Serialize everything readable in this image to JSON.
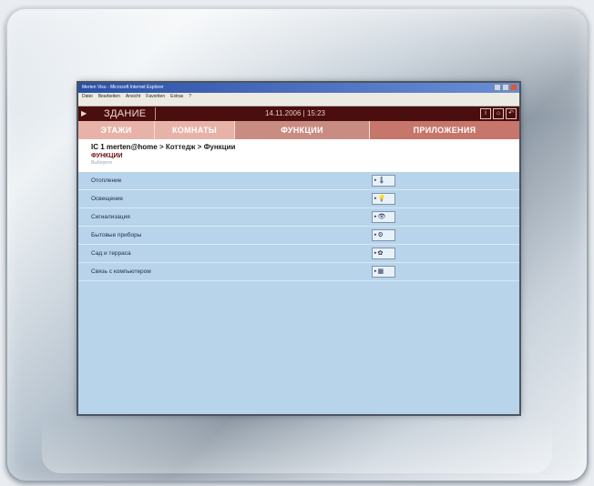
{
  "window": {
    "title": "Merten Visu - Microsoft Internet Explorer",
    "menu": [
      "Datei",
      "Bearbeiten",
      "Ansicht",
      "Favoriten",
      "Extras",
      "?"
    ]
  },
  "header": {
    "title": "ЗДАНИЕ",
    "datetime": "14.11.2006 | 15:23"
  },
  "tabs": [
    "ЭТАЖИ",
    "КОМНАТЫ",
    "ФУНКЦИИ",
    "ПРИЛОЖЕНИЯ"
  ],
  "breadcrumb": {
    "root": "IC 1 merten@home",
    "path": "> Коттедж > Функции"
  },
  "page_title": "ФУНКЦИИ",
  "subtitle": "Выберите",
  "functions": [
    {
      "label": "Отопление",
      "icon": "thermometer-icon",
      "glyph": "🌡"
    },
    {
      "label": "Освещение",
      "icon": "light-bulb-icon",
      "glyph": "💡"
    },
    {
      "label": "Сигнализация",
      "icon": "eye-icon",
      "glyph": "👁"
    },
    {
      "label": "Бытовые приборы",
      "icon": "appliance-icon",
      "glyph": "⚙"
    },
    {
      "label": "Сад и терраса",
      "icon": "garden-icon",
      "glyph": "✿"
    },
    {
      "label": "Связь с компьютером",
      "icon": "computer-icon",
      "glyph": "▦"
    }
  ],
  "colors": {
    "header_bg": "#4a0e0e",
    "tabs_bg": "#e7b3a8",
    "active_tab_bg": "#c98c82",
    "list_bg": "#b8d4ea"
  }
}
